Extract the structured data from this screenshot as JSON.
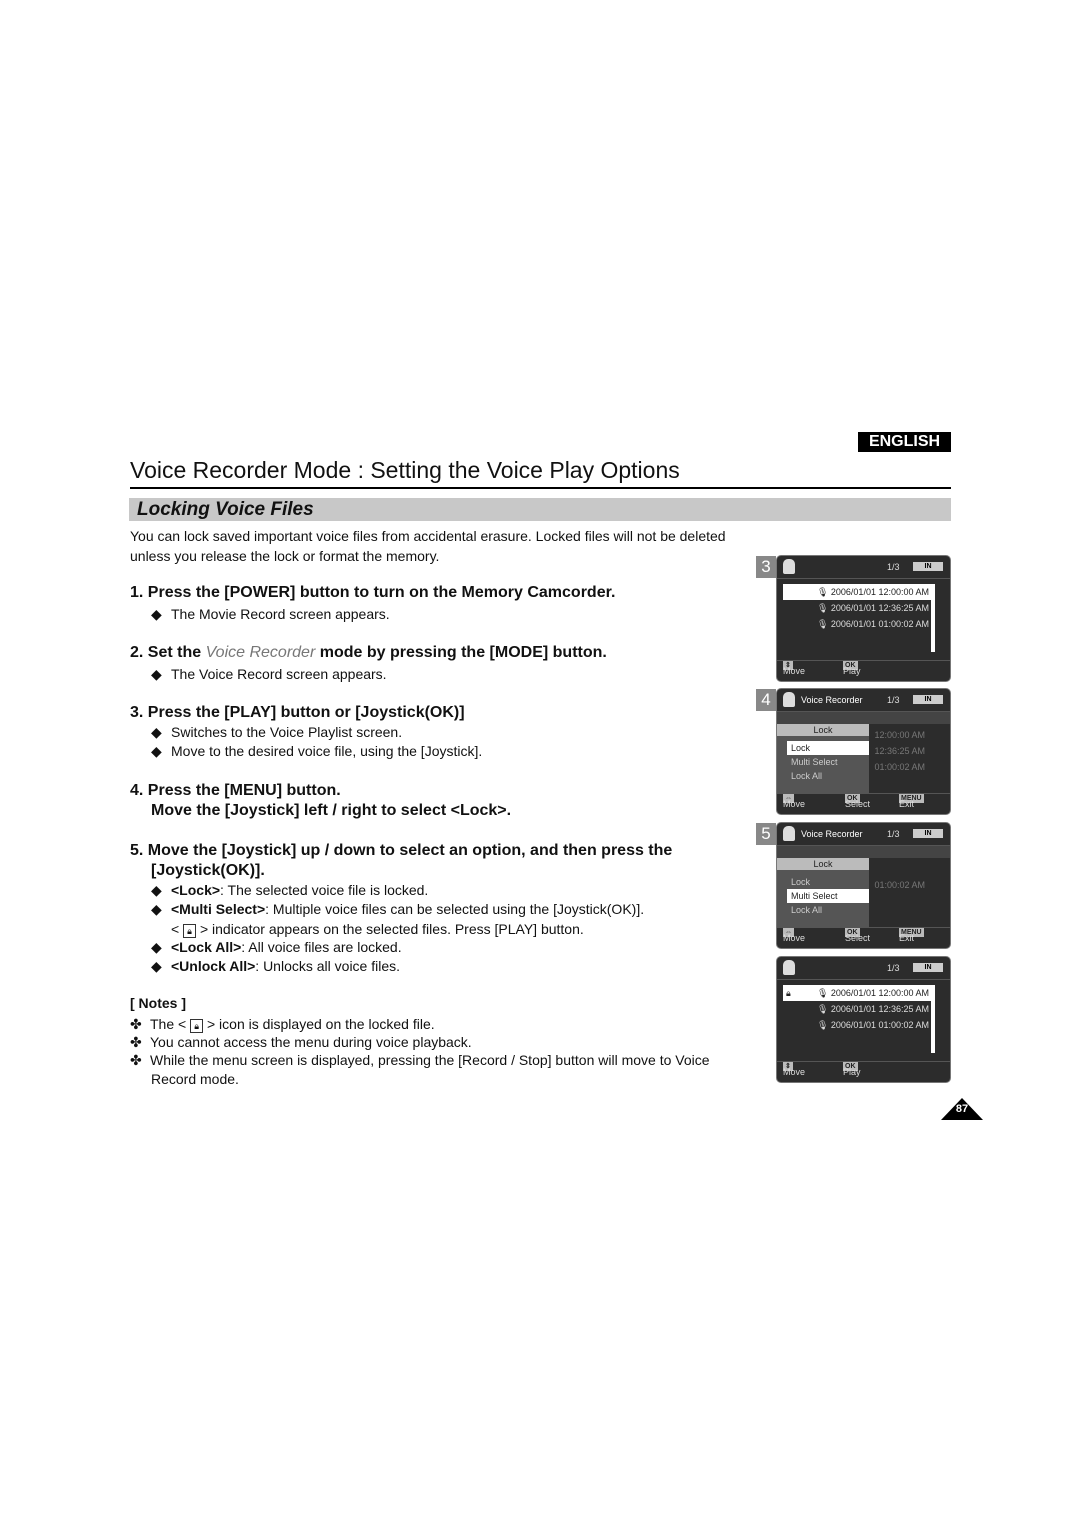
{
  "language_badge": "ENGLISH",
  "title": "Voice Recorder Mode : Setting the Voice Play Options",
  "section": "Locking Voice Files",
  "intro": [
    "You can lock saved important voice files from accidental erasure. Locked files will not be deleted",
    "unless you release the lock or format the memory."
  ],
  "steps": [
    {
      "num": "1.",
      "text": "Press the [POWER] button to turn on the Memory Camcorder.",
      "bullets": [
        "The Movie Record screen appears."
      ]
    },
    {
      "num": "2.",
      "pre": "Set the ",
      "em": "Voice Recorder",
      "post": " mode by pressing the [MODE] button.",
      "bullets": [
        "The Voice Record screen appears."
      ]
    },
    {
      "num": "3.",
      "text": "Press the [PLAY] button or [Joystick(OK)]",
      "bullets": [
        "Switches to the Voice Playlist screen.",
        "Move to the desired voice file, using the [Joystick]."
      ]
    },
    {
      "num": "4.",
      "text": "Press the [MENU] button.",
      "text2": "Move the [Joystick] left / right to select <Lock>."
    },
    {
      "num": "5.",
      "text": "Move the [Joystick] up / down to select an option, and then press the",
      "text2": "[Joystick(OK)].",
      "options": [
        {
          "key": "<Lock>",
          "desc": ": The selected voice file is locked."
        },
        {
          "key": "<Multi Select>",
          "desc": ": Multiple voice files can be selected using the [Joystick(OK)].",
          "sub_pre": "<",
          "sub_post": "> indicator appears on the selected files. Press [PLAY] button."
        },
        {
          "key": "<Lock All>",
          "desc": ": All voice files are locked."
        },
        {
          "key": "<Unlock All>",
          "desc": ": Unlocks all voice files."
        }
      ]
    }
  ],
  "notes": {
    "heading": "[ Notes ]",
    "items": [
      {
        "pre": "The <",
        "post": "> icon is displayed on the locked file."
      },
      {
        "text": "You cannot access the menu during voice playback."
      },
      {
        "text": "While the menu screen is displayed, pressing the [Record / Stop] button will move to Voice",
        "text2": "Record mode."
      }
    ]
  },
  "screens": {
    "counter": "1/3",
    "battery": "IN",
    "title": "Voice Recorder",
    "files": [
      "2006/01/01 12:00:00 AM",
      "2006/01/01 12:36:25 AM",
      "2006/01/01 01:00:02 AM"
    ],
    "files_partial": [
      "12:00:00 AM",
      "12:36:25 AM",
      "01:00:02 AM"
    ],
    "move": "Move",
    "play": "Play",
    "select": "Select",
    "exit": "Exit",
    "ok_key": "OK",
    "menu_key": "MENU",
    "menu_header": "Lock",
    "menu_items": [
      "Lock",
      "Multi Select",
      "Lock All"
    ],
    "labels": [
      "3",
      "4",
      "5"
    ]
  },
  "page_number": "87"
}
